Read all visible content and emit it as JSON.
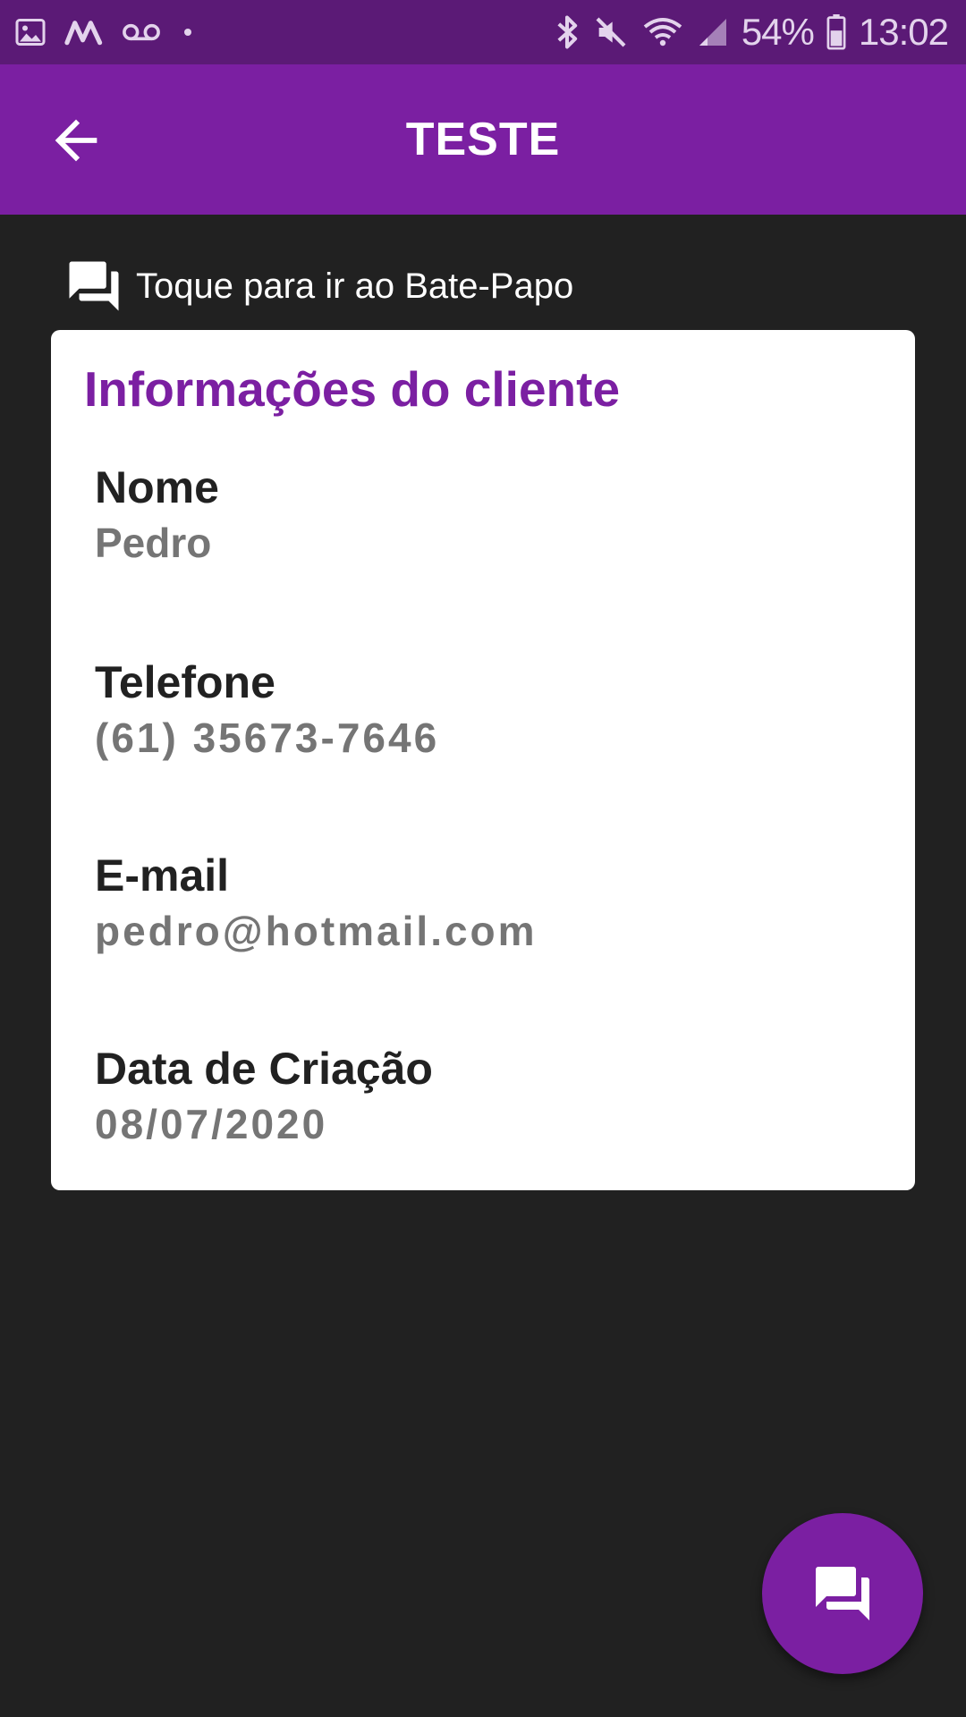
{
  "status_bar": {
    "battery": "54%",
    "time": "13:02",
    "icons": [
      "gallery-icon",
      "carrier-m-icon",
      "voicemail-icon",
      "dot-icon",
      "bluetooth-icon",
      "mute-icon",
      "wifi-icon",
      "signal-icon",
      "battery-icon"
    ]
  },
  "app_bar": {
    "title": "TESTE",
    "back_icon": "arrow-back-icon",
    "color": "#7b1fa2"
  },
  "chat_link": {
    "icon": "forum-icon",
    "label": "Toque para ir ao Bate-Papo"
  },
  "card": {
    "title": "Informações do cliente",
    "fields": [
      {
        "label": "Nome",
        "value": "Pedro"
      },
      {
        "label": "Telefone",
        "value": "(61) 35673-7646"
      },
      {
        "label": "E-mail",
        "value": "pedro@hotmail.com"
      },
      {
        "label": "Data de Criação",
        "value": "08/07/2020"
      }
    ]
  },
  "fab": {
    "icon": "forum-icon",
    "color": "#7b1fa2"
  }
}
